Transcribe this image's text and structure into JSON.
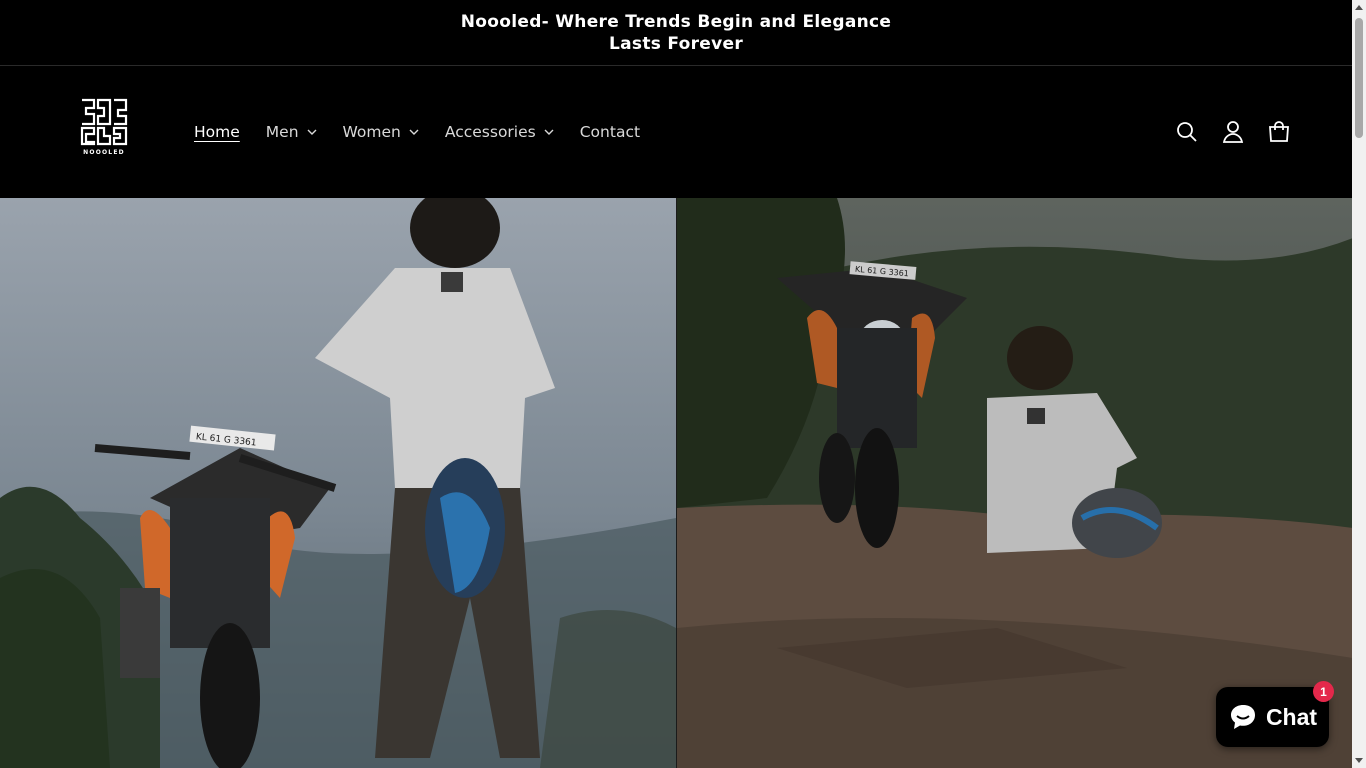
{
  "announcement": {
    "text": "Noooled- Where Trends Begin and Elegance Lasts Forever"
  },
  "brand": {
    "logo_text": "NOOOLED"
  },
  "nav": {
    "items": [
      {
        "label": "Home",
        "active": true,
        "dropdown": false
      },
      {
        "label": "Men",
        "active": false,
        "dropdown": true
      },
      {
        "label": "Women",
        "active": false,
        "dropdown": true
      },
      {
        "label": "Accessories",
        "active": false,
        "dropdown": true
      },
      {
        "label": "Contact",
        "active": false,
        "dropdown": false
      }
    ]
  },
  "header_icons": [
    "search-icon",
    "account-icon",
    "cart-icon"
  ],
  "hero": {
    "left_plate": "KL 61 G 3361",
    "right_plate": "KL 61 G 3361"
  },
  "chat": {
    "label": "Chat",
    "badge": "1"
  },
  "colors": {
    "background": "#000000",
    "text": "#ffffff",
    "badge": "#e4284b"
  }
}
